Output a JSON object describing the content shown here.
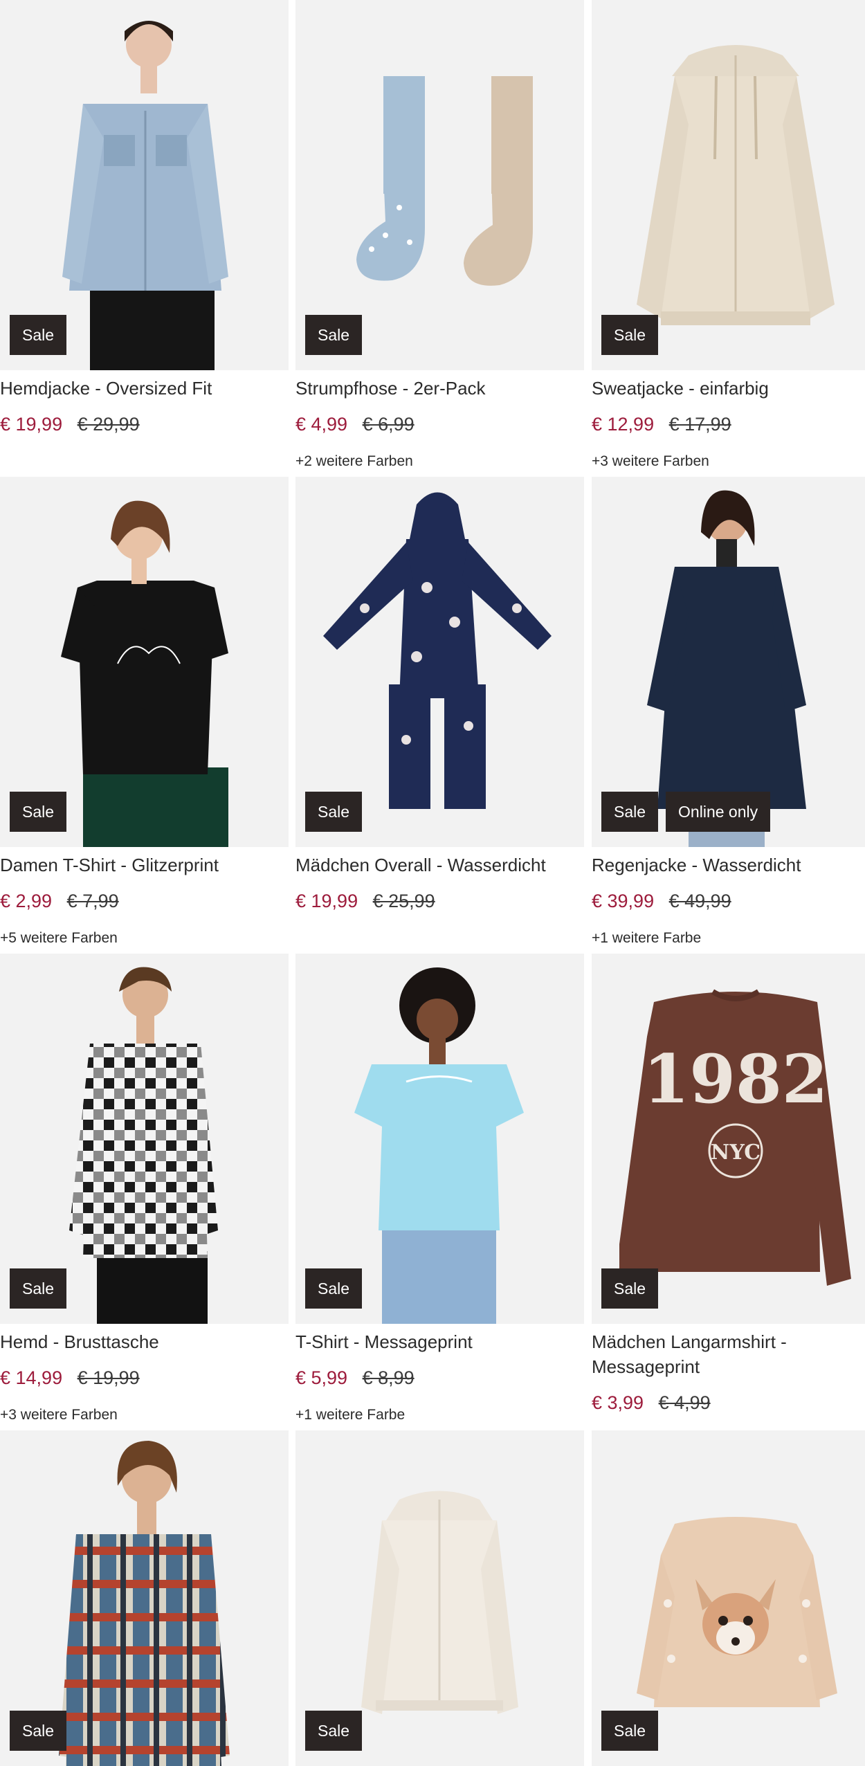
{
  "products": [
    {
      "title": "Hemdjacke - Oversized Fit",
      "price": "€ 19,99",
      "old_price": "€ 29,99",
      "colors": "",
      "badges": [
        "Sale"
      ]
    },
    {
      "title": "Strumpfhose - 2er-Pack",
      "price": "€ 4,99",
      "old_price": "€ 6,99",
      "colors": "+2 weitere Farben",
      "badges": [
        "Sale"
      ]
    },
    {
      "title": "Sweatjacke - einfarbig",
      "price": "€ 12,99",
      "old_price": "€ 17,99",
      "colors": "+3 weitere Farben",
      "badges": [
        "Sale"
      ]
    },
    {
      "title": "Damen T-Shirt - Glitzerprint",
      "price": "€ 2,99",
      "old_price": "€ 7,99",
      "colors": "+5 weitere Farben",
      "badges": [
        "Sale"
      ]
    },
    {
      "title": "Mädchen Overall - Wasserdicht",
      "price": "€ 19,99",
      "old_price": "€ 25,99",
      "colors": "",
      "badges": [
        "Sale"
      ]
    },
    {
      "title": "Regenjacke - Wasserdicht",
      "price": "€ 39,99",
      "old_price": "€ 49,99",
      "colors": "+1 weitere Farbe",
      "badges": [
        "Sale",
        "Online only"
      ]
    },
    {
      "title": "Hemd - Brusttasche",
      "price": "€ 14,99",
      "old_price": "€ 19,99",
      "colors": "+3 weitere Farben",
      "badges": [
        "Sale"
      ]
    },
    {
      "title": "T-Shirt - Messageprint",
      "price": "€ 5,99",
      "old_price": "€ 8,99",
      "colors": "+1 weitere Farbe",
      "badges": [
        "Sale"
      ]
    },
    {
      "title": "Mädchen Langarmshirt - Messageprint",
      "price": "€ 3,99",
      "old_price": "€ 4,99",
      "colors": "",
      "badges": [
        "Sale"
      ]
    },
    {
      "title": "",
      "price": "",
      "old_price": "",
      "colors": "",
      "badges": [
        "Sale"
      ]
    },
    {
      "title": "",
      "price": "",
      "old_price": "",
      "colors": "",
      "badges": [
        "Sale"
      ]
    },
    {
      "title": "",
      "price": "",
      "old_price": "",
      "colors": "",
      "badges": [
        "Sale"
      ]
    }
  ],
  "print_texts": {
    "sweater_year": "1982",
    "sweater_emblem": "NYC"
  },
  "colors": {
    "sale_price": "#9d1c3c",
    "badge_bg": "#2b2524",
    "image_bg": "#f2f2f2"
  },
  "icons": [
    "product-image-denim-jacket",
    "product-image-tights",
    "product-image-zip-hoodie",
    "product-image-tshirt",
    "product-image-overall",
    "product-image-rain-jacket",
    "product-image-check-shirt",
    "product-image-message-tshirt",
    "product-image-longsleeve",
    "product-image-plaid-shirt",
    "product-image-cream-hoodie",
    "product-image-fawn-sweater"
  ]
}
